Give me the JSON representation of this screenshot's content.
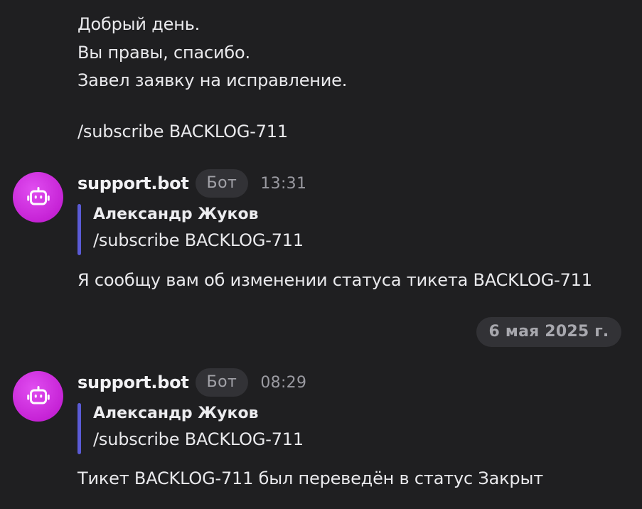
{
  "earlier_message": {
    "lines": [
      "Добрый день.",
      "Вы правы, спасибо.",
      "Завел заявку на исправление.",
      "/subscribe BACKLOG-711"
    ]
  },
  "messages": [
    {
      "author": "support.bot",
      "badge": "Бот",
      "time": "13:31",
      "avatar_icon": "robot-icon",
      "quote": {
        "author": "Александр Жуков",
        "text": "/subscribe BACKLOG-711"
      },
      "text": "Я сообщу вам об изменении статуса тикета BACKLOG-711"
    },
    {
      "author": "support.bot",
      "badge": "Бот",
      "time": "08:29",
      "avatar_icon": "robot-icon",
      "quote": {
        "author": "Александр Жуков",
        "text": "/subscribe BACKLOG-711"
      },
      "text": "Тикет BACKLOG-711 был переведён в статус Закрыт"
    }
  ],
  "date_separator": "6 мая 2025 г.",
  "colors": {
    "background": "#1f1f21",
    "avatar": "#c623d6",
    "quote_bar": "#5b5bd6",
    "badge_background": "#323236"
  }
}
